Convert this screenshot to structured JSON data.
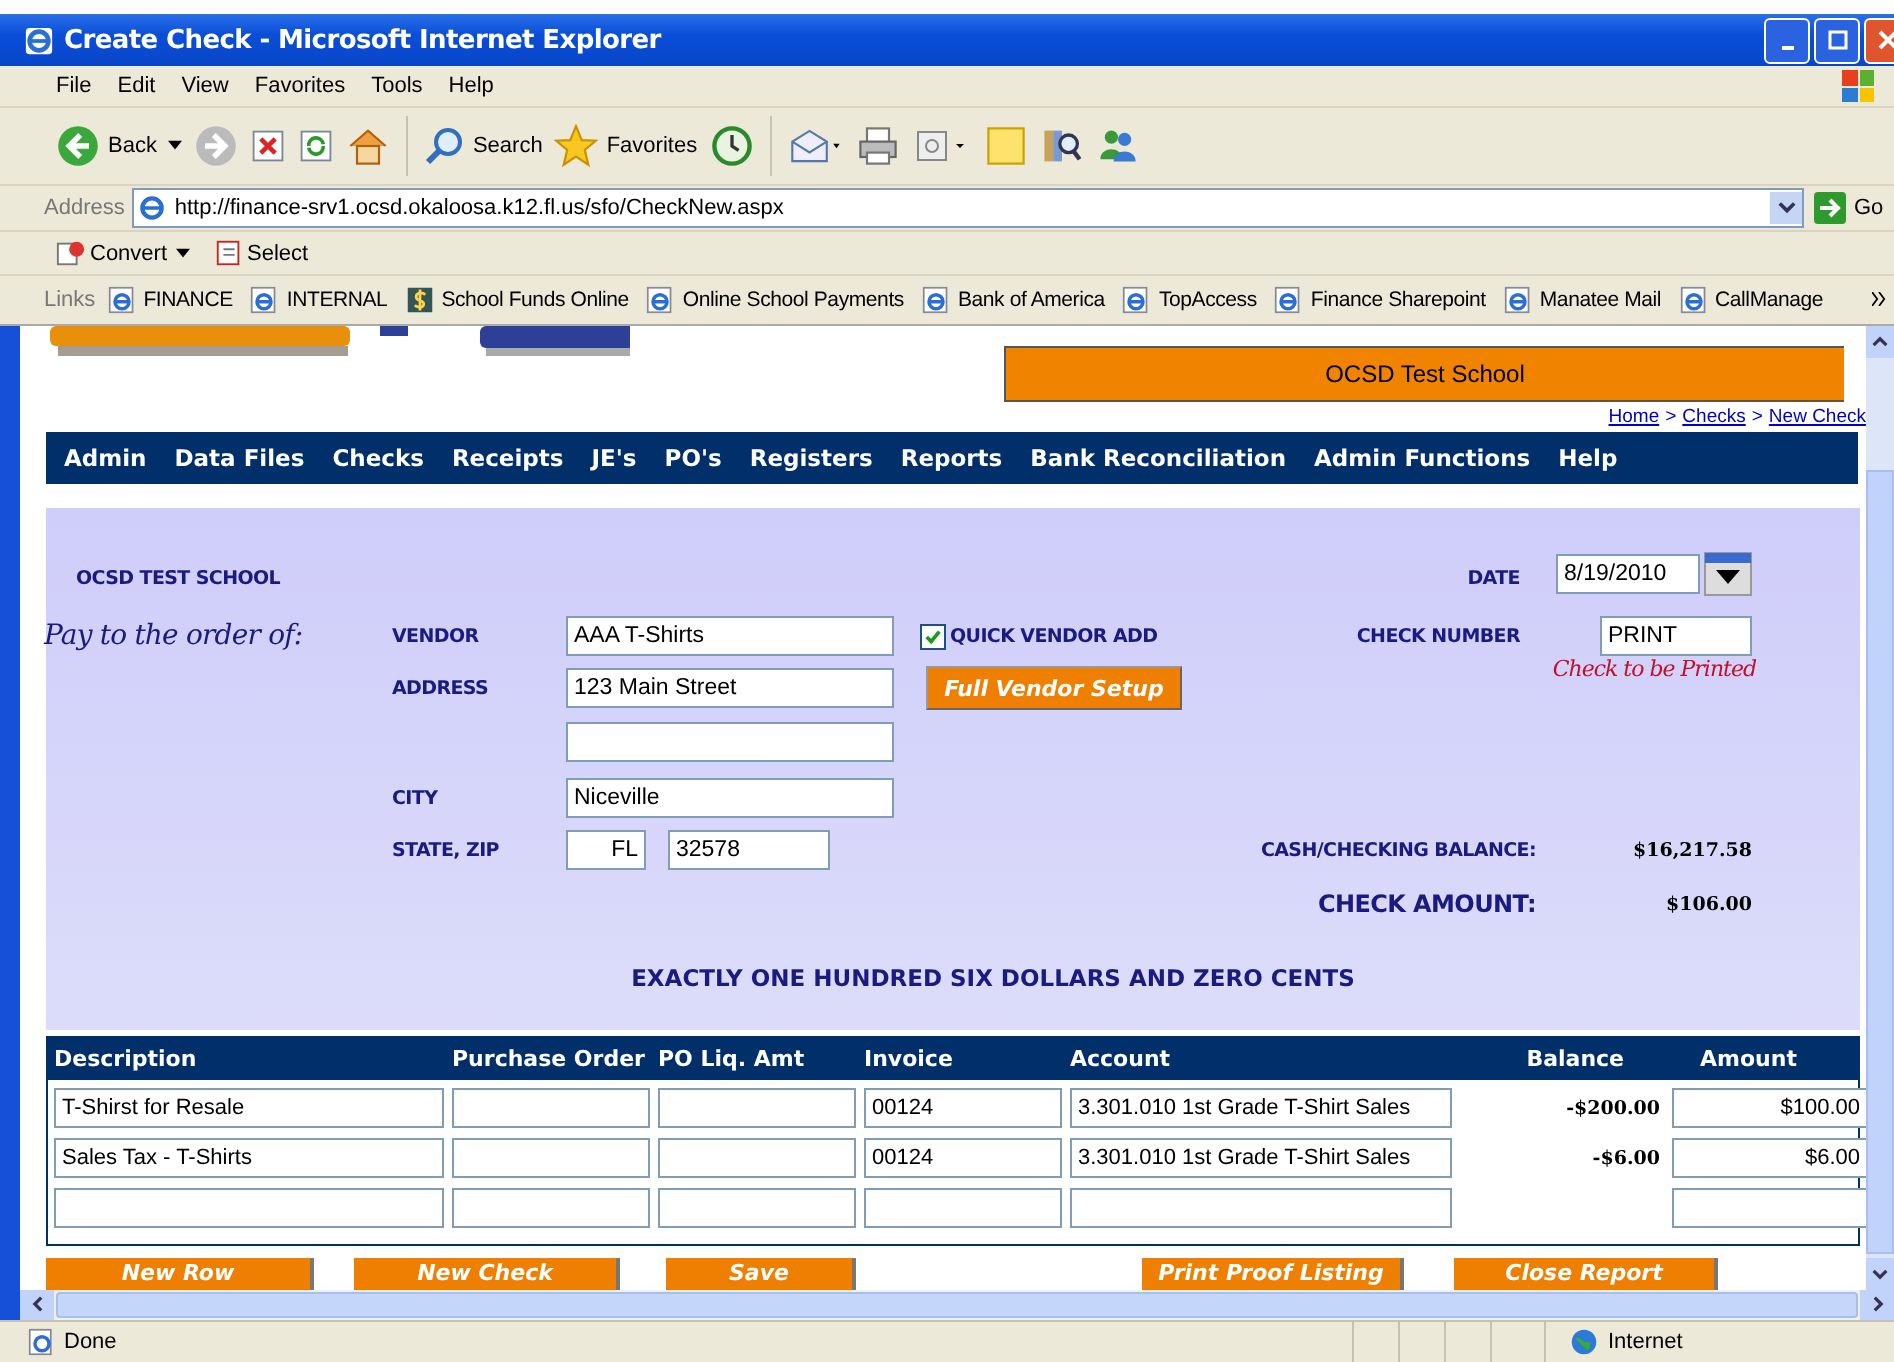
{
  "window": {
    "title": "Create Check - Microsoft Internet Explorer"
  },
  "menu": [
    "File",
    "Edit",
    "View",
    "Favorites",
    "Tools",
    "Help"
  ],
  "toolbar": {
    "back": "Back",
    "search": "Search",
    "favorites": "Favorites"
  },
  "address": {
    "label": "Address",
    "url": "http://finance-srv1.ocsd.okaloosa.k12.fl.us/sfo/CheckNew.aspx",
    "go": "Go"
  },
  "convert_bar": {
    "convert": "Convert",
    "select": "Select"
  },
  "links": {
    "label": "Links",
    "items": [
      {
        "label": "FINANCE",
        "kind": "page"
      },
      {
        "label": "INTERNAL",
        "kind": "page"
      },
      {
        "label": "School Funds Online",
        "kind": "dollar"
      },
      {
        "label": "Online School Payments",
        "kind": "page"
      },
      {
        "label": "Bank of America",
        "kind": "page"
      },
      {
        "label": "TopAccess",
        "kind": "page"
      },
      {
        "label": "Finance Sharepoint",
        "kind": "page"
      },
      {
        "label": "Manatee Mail",
        "kind": "page"
      },
      {
        "label": "CallManage",
        "kind": "page"
      }
    ]
  },
  "page": {
    "banner": "OCSD Test School",
    "breadcrumb": {
      "separator": ">",
      "items": [
        "Home",
        "Checks",
        "New Check"
      ]
    },
    "nav": [
      "Admin",
      "Data Files",
      "Checks",
      "Receipts",
      "JE's",
      "PO's",
      "Registers",
      "Reports",
      "Bank Reconciliation",
      "Admin Functions",
      "Help"
    ],
    "form": {
      "school": "OCSD TEST SCHOOL",
      "pay_to": "Pay to the order of:",
      "vendor": {
        "label": "VENDOR",
        "value": "AAA T-Shirts"
      },
      "quick_vendor_add": {
        "label": "QUICK VENDOR ADD",
        "checked": true
      },
      "address": {
        "label": "ADDRESS",
        "line1": "123 Main Street"
      },
      "full_vendor_setup": "Full Vendor Setup",
      "city": {
        "label": "CITY",
        "value": "Niceville"
      },
      "state_zip": {
        "label": "STATE, ZIP",
        "state": "FL",
        "zip": "32578"
      },
      "date": {
        "label": "DATE",
        "value": "8/19/2010"
      },
      "check_number": {
        "label": "CHECK NUMBER",
        "value": "PRINT",
        "note": "Check to be Printed"
      },
      "balance": {
        "label": "CASH/CHECKING BALANCE:",
        "value": "$16,217.58"
      },
      "check_amount": {
        "label": "CHECK AMOUNT:",
        "value": "$106.00"
      },
      "amount_words": "EXACTLY ONE HUNDRED SIX DOLLARS AND ZERO CENTS"
    },
    "table": {
      "columns": [
        "Description",
        "Purchase Order",
        "PO Liq. Amt",
        "Invoice",
        "Account",
        "Balance",
        "Amount"
      ],
      "rows": [
        {
          "description": "T-Shirst for Resale",
          "invoice": "00124",
          "account": "3.301.010 1st Grade T-Shirt Sales",
          "balance": "-$200.00",
          "amount": "$100.00"
        },
        {
          "description": "Sales Tax - T-Shirts",
          "invoice": "00124",
          "account": "3.301.010 1st Grade T-Shirt Sales",
          "balance": "-$6.00",
          "amount": "$6.00"
        },
        {}
      ]
    },
    "buttons": [
      "New Row",
      "New Check",
      "Save",
      "Print Proof Listing",
      "Close Report"
    ]
  },
  "status_bar": {
    "text": "Done",
    "zone": "Internet"
  }
}
